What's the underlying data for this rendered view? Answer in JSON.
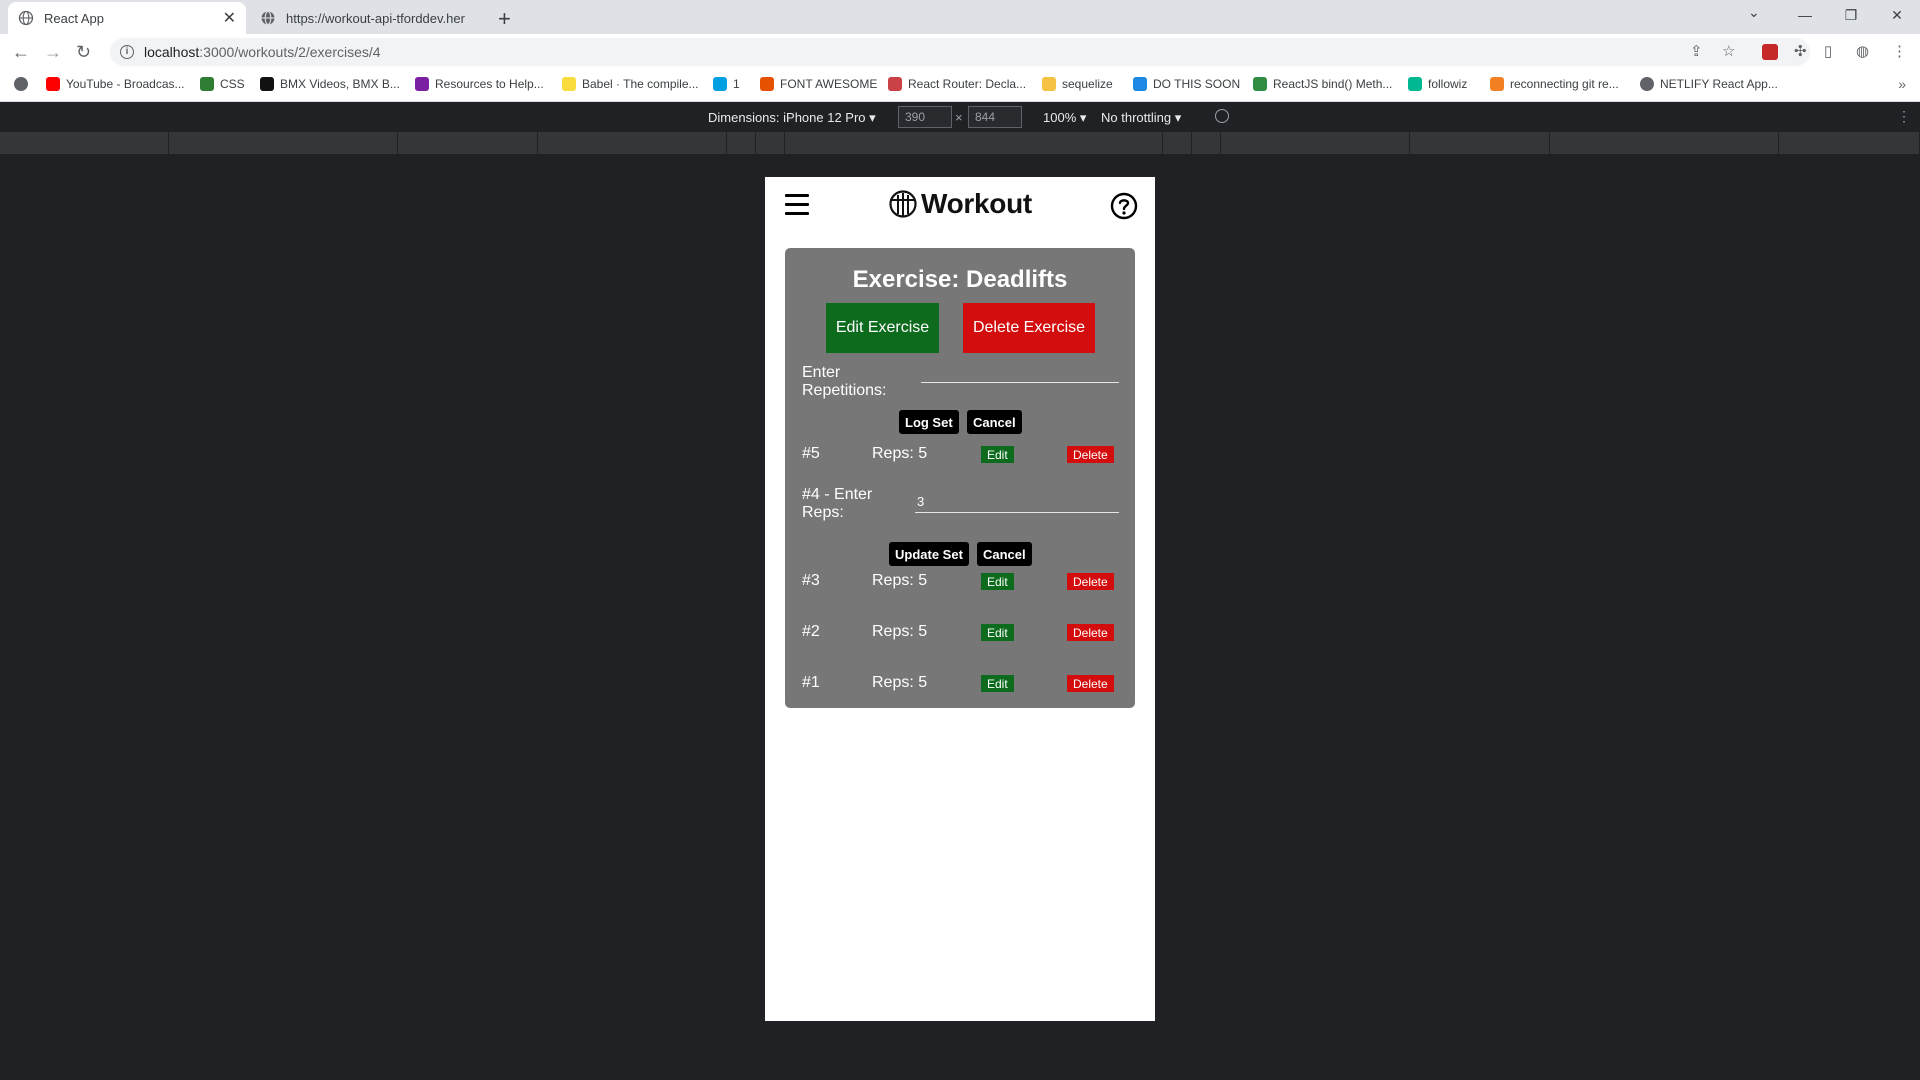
{
  "browser": {
    "tabs": [
      {
        "title": "React App",
        "active": true
      },
      {
        "title": "https://workout-api-tforddev.her",
        "active": false
      }
    ],
    "new_tab_glyph": "+",
    "url_host": "localhost",
    "url_path": ":3000/workouts/2/exercises/4",
    "bookmarks": [
      {
        "label": "YouTube - Broadcas...",
        "icon": "youtube-icon",
        "color": "#ff0000"
      },
      {
        "label": "CSS",
        "icon": "w3-icon",
        "color": "#2e7d32"
      },
      {
        "label": "BMX Videos, BMX B...",
        "icon": "mj-icon",
        "color": "#111111"
      },
      {
        "label": "Resources to Help...",
        "icon": "resources-icon",
        "color": "#7b1fa2"
      },
      {
        "label": "Babel · The compile...",
        "icon": "babel-icon",
        "color": "#f9dc3e"
      },
      {
        "label": "1",
        "icon": "link-icon",
        "color": "#00a0e3"
      },
      {
        "label": "FONT AWESOME",
        "icon": "code-icon",
        "color": "#e65100"
      },
      {
        "label": "React Router: Decla...",
        "icon": "react-router-icon",
        "color": "#ca4245"
      },
      {
        "label": "sequelize",
        "icon": "folder-icon",
        "color": "#f6c244"
      },
      {
        "label": "DO THIS SOON",
        "icon": "doc-icon",
        "color": "#1e88e5"
      },
      {
        "label": "ReactJS bind() Meth...",
        "icon": "gfg-icon",
        "color": "#2f8d46"
      },
      {
        "label": "followiz",
        "icon": "followiz-icon",
        "color": "#00b894"
      },
      {
        "label": "reconnecting git re...",
        "icon": "stack-icon",
        "color": "#f48024"
      },
      {
        "label": "NETLIFY React App...",
        "icon": "globe-icon",
        "color": "#5f6368"
      }
    ]
  },
  "devtools": {
    "dimensions_label": "Dimensions: iPhone 12 Pro",
    "width": "390",
    "height": "844",
    "times": "×",
    "zoom": "100%",
    "throttling": "No throttling"
  },
  "app": {
    "title": "Workout",
    "exercise_title": "Exercise: Deadlifts",
    "edit_exercise": "Edit Exercise",
    "delete_exercise": "Delete Exercise",
    "enter_reps_label_1": "Enter",
    "enter_reps_label_2": "Repetitions:",
    "reps_value": "",
    "log_set": "Log Set",
    "cancel": "Cancel",
    "edit": "Edit",
    "delete": "Delete",
    "update_set": "Update Set",
    "edit_row_label_1": "#4 - Enter",
    "edit_row_label_2": "Reps:",
    "edit_row_value": "3",
    "sets": [
      {
        "num": "#5",
        "reps": "Reps: 5"
      },
      {
        "num": "#3",
        "reps": "Reps: 5"
      },
      {
        "num": "#2",
        "reps": "Reps: 5"
      },
      {
        "num": "#1",
        "reps": "Reps: 5"
      }
    ]
  },
  "colors": {
    "green_button": "#0d6b1e",
    "red_button": "#d30d0d",
    "card_bg": "#777777"
  }
}
